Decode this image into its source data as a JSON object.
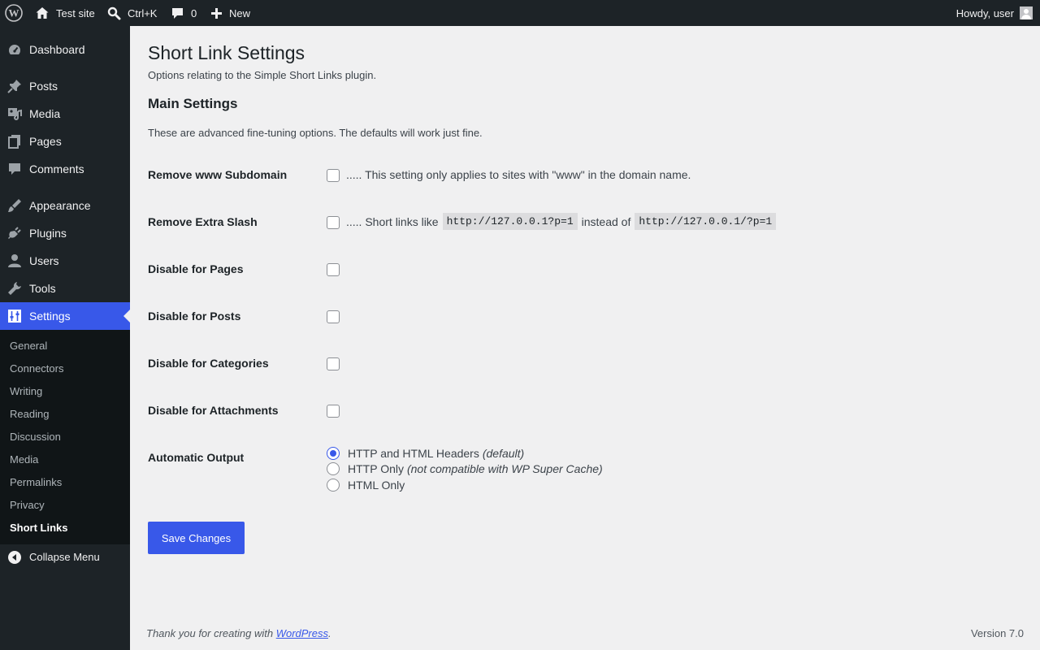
{
  "admin_bar": {
    "site_name": "Test site",
    "search_shortcut": "Ctrl+K",
    "comments_count": "0",
    "new_label": "New",
    "howdy": "Howdy, user"
  },
  "sidebar": {
    "items": [
      {
        "label": "Dashboard",
        "icon": "dashboard-icon"
      },
      {
        "label": "Posts",
        "icon": "pin-icon"
      },
      {
        "label": "Media",
        "icon": "media-icon"
      },
      {
        "label": "Pages",
        "icon": "pages-icon"
      },
      {
        "label": "Comments",
        "icon": "comment-icon"
      },
      {
        "label": "Appearance",
        "icon": "brush-icon"
      },
      {
        "label": "Plugins",
        "icon": "plug-icon"
      },
      {
        "label": "Users",
        "icon": "user-icon"
      },
      {
        "label": "Tools",
        "icon": "wrench-icon"
      },
      {
        "label": "Settings",
        "icon": "sliders-icon"
      }
    ],
    "submenu": [
      "General",
      "Connectors",
      "Writing",
      "Reading",
      "Discussion",
      "Media",
      "Permalinks",
      "Privacy",
      "Short Links"
    ],
    "collapse_label": "Collapse Menu"
  },
  "page": {
    "title": "Short Link Settings",
    "description": "Options relating to the Simple Short Links plugin.",
    "section_title": "Main Settings",
    "section_description": "These are advanced fine-tuning options. The defaults will work just fine."
  },
  "settings": {
    "remove_www": {
      "label": "Remove www Subdomain",
      "description": "..... This setting only applies to sites with \"www\" in the domain name.",
      "checked": false
    },
    "remove_slash": {
      "label": "Remove Extra Slash",
      "desc_prefix": "..... Short links like",
      "code1": "http://127.0.0.1?p=1",
      "desc_middle": "instead of",
      "code2": "http://127.0.0.1/?p=1",
      "checked": false
    },
    "disable_pages": {
      "label": "Disable for Pages",
      "checked": false
    },
    "disable_posts": {
      "label": "Disable for Posts",
      "checked": false
    },
    "disable_categories": {
      "label": "Disable for Categories",
      "checked": false
    },
    "disable_attachments": {
      "label": "Disable for Attachments",
      "checked": false
    },
    "automatic_output": {
      "label": "Automatic Output",
      "options": [
        {
          "label": "HTTP and HTML Headers",
          "note": "(default)",
          "checked": true
        },
        {
          "label": "HTTP Only",
          "note": "(not compatible with WP Super Cache)",
          "checked": false
        },
        {
          "label": "HTML Only",
          "note": "",
          "checked": false
        }
      ]
    }
  },
  "save_button": "Save Changes",
  "footer": {
    "thanks_prefix": "Thank you for creating with",
    "wordpress_link": "WordPress",
    "thanks_suffix": ".",
    "version": "Version 7.0"
  },
  "colors": {
    "accent": "#3858e9",
    "sidebar_bg": "#1d2327",
    "submenu_bg": "#101517",
    "page_bg": "#f0f0f1"
  }
}
